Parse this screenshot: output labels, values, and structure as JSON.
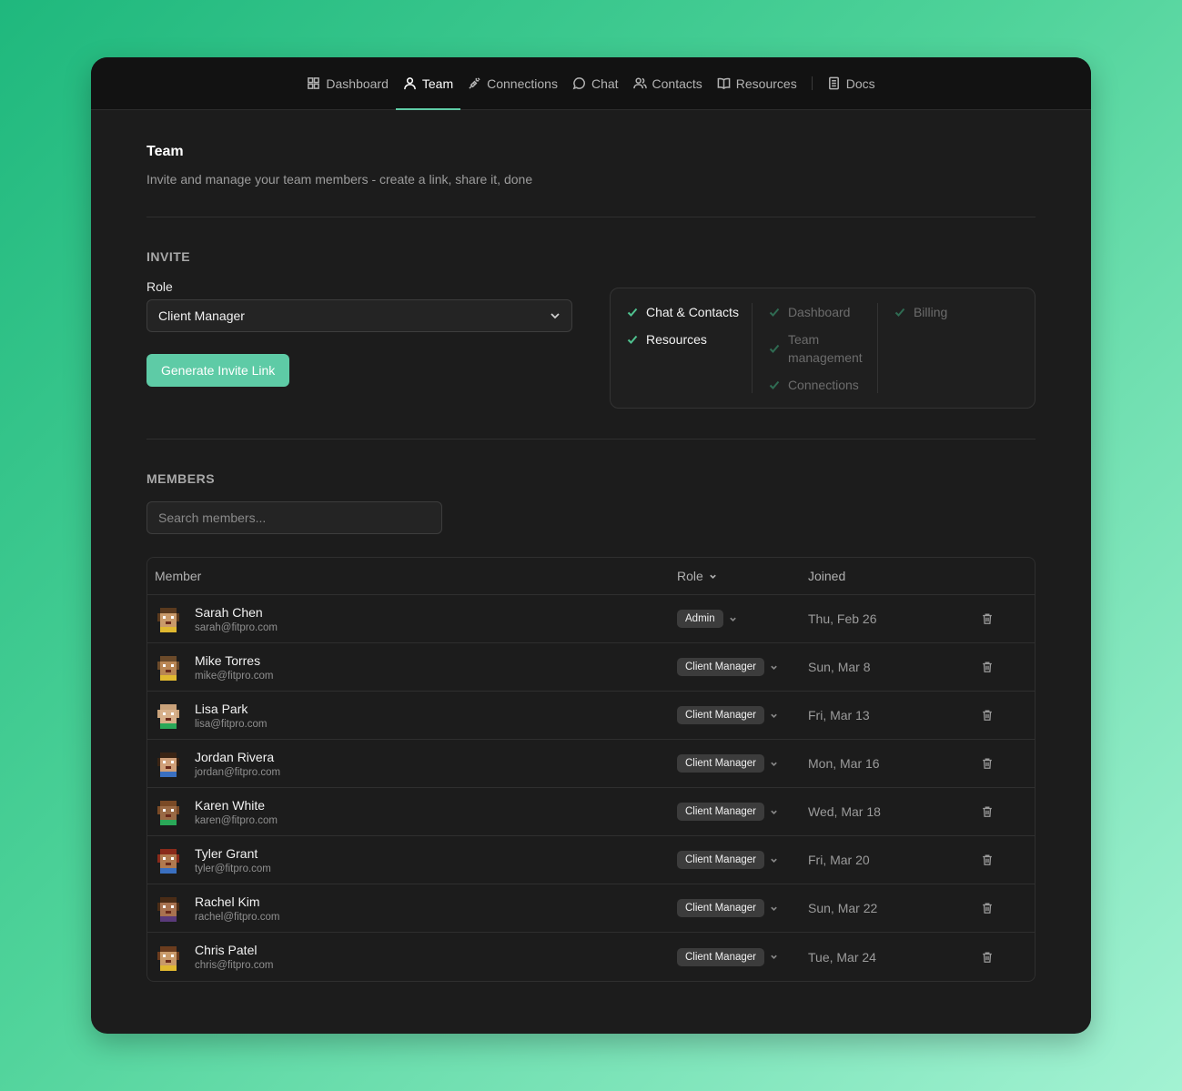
{
  "nav": {
    "items": [
      {
        "label": "Dashboard",
        "icon": "grid-icon"
      },
      {
        "label": "Team",
        "icon": "user-icon"
      },
      {
        "label": "Connections",
        "icon": "plug-icon"
      },
      {
        "label": "Chat",
        "icon": "chat-bubble-icon"
      },
      {
        "label": "Contacts",
        "icon": "users-icon"
      },
      {
        "label": "Resources",
        "icon": "book-icon"
      },
      {
        "label": "Docs",
        "icon": "document-icon"
      }
    ],
    "active": "Team"
  },
  "page": {
    "title": "Team",
    "subtitle": "Invite and manage your team members - create a link, share it, done"
  },
  "invite": {
    "section_label": "INVITE",
    "role_label": "Role",
    "role_value": "Client Manager",
    "button_label": "Generate Invite Link",
    "permissions": {
      "enabled": [
        "Chat & Contacts",
        "Resources"
      ],
      "disabled_col1": [
        "Dashboard",
        "Team management",
        "Connections"
      ],
      "disabled_col2": [
        "Billing"
      ]
    }
  },
  "members": {
    "section_label": "MEMBERS",
    "search_placeholder": "Search members...",
    "columns": {
      "member": "Member",
      "role": "Role",
      "joined": "Joined"
    },
    "rows": [
      {
        "name": "Sarah Chen",
        "email": "sarah@fitpro.com",
        "role": "Admin",
        "joined": "Thu, Feb 26"
      },
      {
        "name": "Mike Torres",
        "email": "mike@fitpro.com",
        "role": "Client Manager",
        "joined": "Sun, Mar 8"
      },
      {
        "name": "Lisa Park",
        "email": "lisa@fitpro.com",
        "role": "Client Manager",
        "joined": "Fri, Mar 13"
      },
      {
        "name": "Jordan Rivera",
        "email": "jordan@fitpro.com",
        "role": "Client Manager",
        "joined": "Mon, Mar 16"
      },
      {
        "name": "Karen White",
        "email": "karen@fitpro.com",
        "role": "Client Manager",
        "joined": "Wed, Mar 18"
      },
      {
        "name": "Tyler Grant",
        "email": "tyler@fitpro.com",
        "role": "Client Manager",
        "joined": "Fri, Mar 20"
      },
      {
        "name": "Rachel Kim",
        "email": "rachel@fitpro.com",
        "role": "Client Manager",
        "joined": "Sun, Mar 22"
      },
      {
        "name": "Chris Patel",
        "email": "chris@fitpro.com",
        "role": "Client Manager",
        "joined": "Tue, Mar 24"
      }
    ]
  },
  "colors": {
    "accent": "#5ecba6",
    "background": "#1c1c1c",
    "nav": "#121212"
  }
}
